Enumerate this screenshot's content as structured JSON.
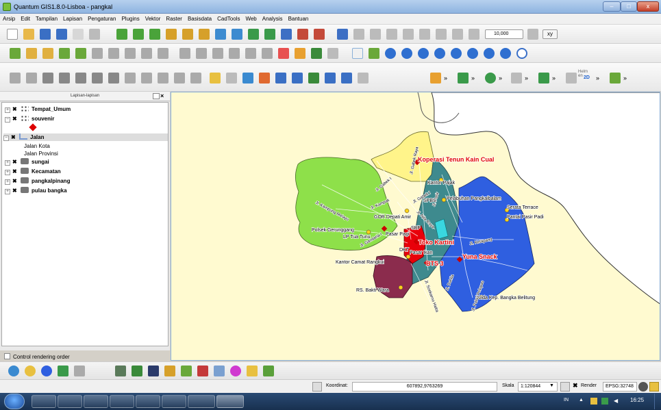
{
  "window": {
    "title": "Quantum GIS1.8.0-Lisboa - pangkal",
    "minimize": "–",
    "maximize": "□",
    "close": "x"
  },
  "menu": [
    "Arsip",
    "Edit",
    "Tampilan",
    "Lapisan",
    "Pengaturan",
    "Plugins",
    "Vektor",
    "Raster",
    "Basisdata",
    "CadTools",
    "Web",
    "Analysis",
    "Bantuan"
  ],
  "toolbar": {
    "scale_combo": "10,000",
    "xy_label": "xy",
    "more": "»",
    "helm_label": "Helm en",
    "helm_sub": "2D"
  },
  "layers_panel": {
    "title": "Lapisan-lapisan",
    "items": [
      {
        "name": "Tempat_Umum",
        "expander": "+"
      },
      {
        "name": "souvenir",
        "expander": "−"
      },
      {
        "name": "Jalan",
        "expander": "−"
      },
      {
        "name": "Jalan Kota"
      },
      {
        "name": "Jalan Provinsi"
      },
      {
        "name": "sungai",
        "expander": "+"
      },
      {
        "name": "Kecamatan",
        "expander": "+"
      },
      {
        "name": "pangkalpinang",
        "expander": "+"
      },
      {
        "name": "pulau bangka",
        "expander": "+"
      }
    ],
    "control_rendering": "Control rendering order"
  },
  "map": {
    "labels_red": [
      "Koperasi Tenun Kain Cual",
      "Toko Kartini",
      "Yuna Snack",
      "BTS 3"
    ],
    "labels_black": [
      "Kantor Pajak",
      "SPBU",
      "Pelabuhan Pangkalbalam",
      "Serata Terrace",
      "Pantai Pasir Padi",
      "GOR Depati Amir",
      "Polsek Gerunggang",
      "LP Tua Tunu",
      "Pasar Pagi",
      "SBP",
      "DKT",
      "Pasar Ikan",
      "Kantor Camat Rangkui",
      "RS. Bakti Wara",
      "Polda Kep. Bangka Belitung"
    ],
    "road_labels": [
      "Jl. Gabek Raya",
      "Jl. Gabek I",
      "Jl. Gabek I",
      "Jl. Pasir",
      "Jl. Kampung Melayu",
      "Jl. Kampak",
      "Jl. Nila Raya",
      "Jl. Gandaria I",
      "Jl. Ketapang",
      "Jl. Dahlia",
      "Jl. Soekarno Hatta",
      "Jl. Pulau Pelepas"
    ],
    "colors": {
      "background": "#fffad0",
      "north": "#fff48a",
      "west": "#8ee04a",
      "teal": "#3e8a8e",
      "east": "#2f5fe0",
      "maroon": "#8b2c4d",
      "red": "#e8000a",
      "cyan": "#39d7e0"
    }
  },
  "status": {
    "koordinat_label": "Koordinat:",
    "koordinat_value": "607892,9763269",
    "skala_label": "Skala",
    "skala_value": "1:120844",
    "render_label": "Render",
    "epsg": "EPSG:32748"
  },
  "taskbar": {
    "lang": "IN",
    "time": "16:25"
  }
}
